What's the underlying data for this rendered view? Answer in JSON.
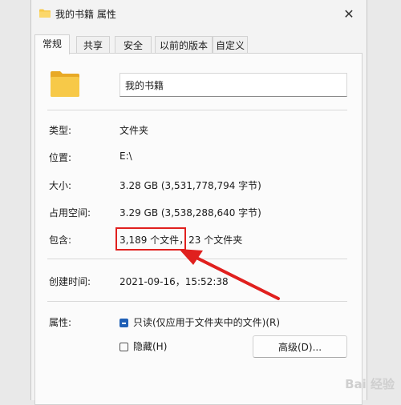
{
  "window": {
    "title": "我的书籍 属性",
    "close_glyph": "✕"
  },
  "tabs": [
    {
      "label": "常规",
      "active": true
    },
    {
      "label": "共享"
    },
    {
      "label": "安全"
    },
    {
      "label": "以前的版本"
    },
    {
      "label": "自定义"
    }
  ],
  "general": {
    "name_value": "我的书籍",
    "type_label": "类型:",
    "type_value": "文件夹",
    "location_label": "位置:",
    "location_value": "E:\\",
    "size_label": "大小:",
    "size_value": "3.28 GB (3,531,778,794 字节)",
    "size_on_disk_label": "占用空间:",
    "size_on_disk_value": "3.29 GB (3,538,288,640 字节)",
    "contains_label": "包含:",
    "contains_value": "3,189 个文件，23 个文件夹",
    "created_label": "创建时间:",
    "created_value": "2021-09-16，15:52:38",
    "attributes_label": "属性:",
    "readonly_label": "只读(仅应用于文件夹中的文件)(R)",
    "readonly_checked": true,
    "hidden_label": "隐藏(H)",
    "hidden_checked": false,
    "advanced_button": "高级(D)..."
  },
  "colors": {
    "accent": "#1f5fb6",
    "annotation": "#e0201e",
    "folder": "#f7c948"
  },
  "watermark": "Bai 经验"
}
